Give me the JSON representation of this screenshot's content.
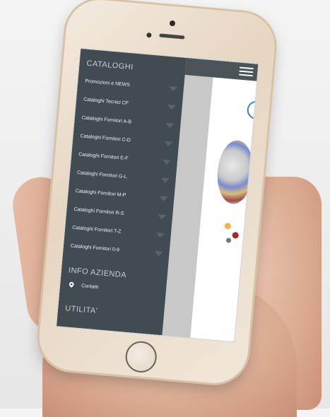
{
  "menu": {
    "sections": {
      "cataloghi": "CATALOGHI",
      "info": "INFO AZIENDA",
      "utilita": "UTILITA'"
    },
    "items": [
      {
        "label": "Promozioni e NEWS"
      },
      {
        "label": "Cataloghi Tecnici CF"
      },
      {
        "label": "Cataloghi Fornitori A-B"
      },
      {
        "label": "Cataloghi Fornitori C-D"
      },
      {
        "label": "Cataloghi Fornitori E-F"
      },
      {
        "label": "Cataloghi Fornitori G-L"
      },
      {
        "label": "Cataloghi Fornitori M-P"
      },
      {
        "label": "Cataloghi Fornitori R-S"
      },
      {
        "label": "Cataloghi Fornitori T-Z"
      },
      {
        "label": "Cataloghi Fornitori 0-9"
      }
    ],
    "contact_label": "Contatti"
  },
  "icons": {
    "menu": "hamburger-icon",
    "expand": "triangle-down-icon",
    "location": "map-pin-icon"
  },
  "colors": {
    "drawer_bg": "#414c52",
    "topbar_bg": "#4a5459",
    "drawer_text": "#eef1f2",
    "section_text": "#c9cfd2"
  }
}
